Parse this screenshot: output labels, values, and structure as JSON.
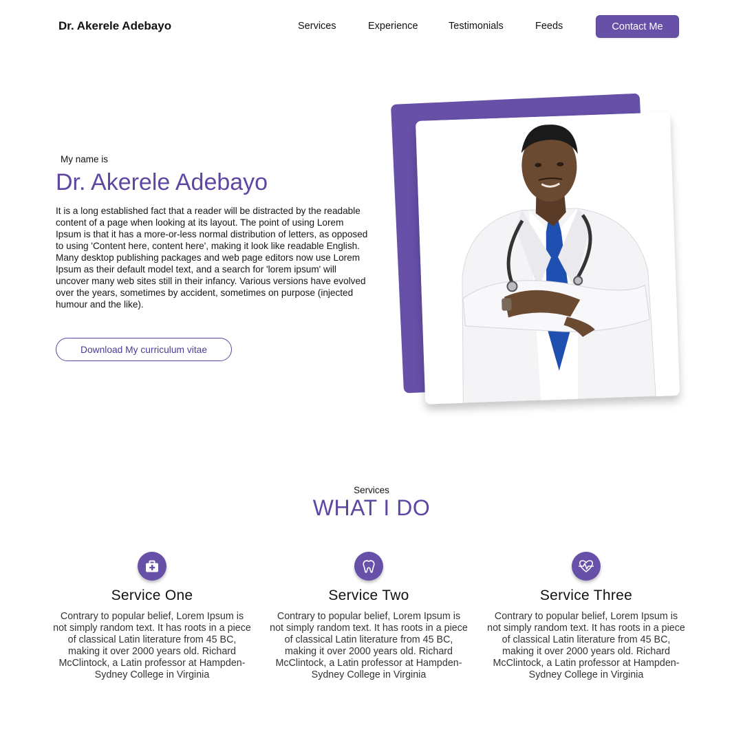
{
  "header": {
    "brand": "Dr. Akerele Adebayo",
    "nav": [
      "Services",
      "Experience",
      "Testimonials",
      "Feeds"
    ],
    "contact_label": "Contact Me"
  },
  "hero": {
    "intro": "My name is",
    "name": "Dr. Akerele Adebayo",
    "bio": "It is a long established fact that a reader will be distracted by the readable content of a page when looking at its layout. The point of using Lorem Ipsum is that it has a more-or-less normal distribution of letters, as opposed to using 'Content here, content here', making it look like readable English. Many desktop publishing packages and web page editors now use Lorem Ipsum as their default model text, and a search for 'lorem ipsum' will uncover many web sites still in their infancy. Various versions have evolved over the years, sometimes by accident, sometimes on purpose (injected humour and the like).",
    "cv_button": "Download My curriculum vitae"
  },
  "services": {
    "kicker": "Services",
    "title": "WHAT I DO",
    "items": [
      {
        "icon": "medical-kit-icon",
        "title": "Service One",
        "text": "Contrary to popular belief, Lorem Ipsum is not simply random text. It has roots in a piece of classical Latin literature from 45 BC, making it over 2000 years old. Richard McClintock, a Latin professor at Hampden-Sydney College in Virginia"
      },
      {
        "icon": "tooth-icon",
        "title": "Service Two",
        "text": "Contrary to popular belief, Lorem Ipsum is not simply random text. It has roots in a piece of classical Latin literature from 45 BC, making it over 2000 years old. Richard McClintock, a Latin professor at Hampden-Sydney College in Virginia"
      },
      {
        "icon": "heartbeat-icon",
        "title": "Service Three",
        "text": "Contrary to popular belief, Lorem Ipsum is not simply random text. It has roots in a piece of classical Latin literature from 45 BC, making it over 2000 years old. Richard McClintock, a Latin professor at Hampden-Sydney College in Virginia"
      }
    ]
  },
  "colors": {
    "accent": "#6650a8",
    "heading_purple": "#5e46a3",
    "text": "#111111"
  }
}
